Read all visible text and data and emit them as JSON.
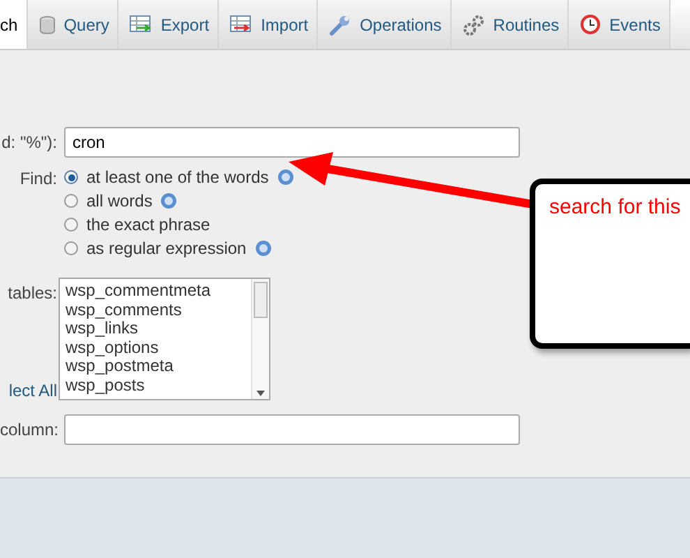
{
  "tabs": [
    {
      "label": "ch",
      "selected": true
    },
    {
      "label": "Query",
      "selected": false
    },
    {
      "label": "Export",
      "selected": false
    },
    {
      "label": "Import",
      "selected": false
    },
    {
      "label": "Operations",
      "selected": false
    },
    {
      "label": "Routines",
      "selected": false
    },
    {
      "label": "Events",
      "selected": false
    }
  ],
  "search": {
    "label": "d: \"%\"):",
    "value": "cron"
  },
  "find": {
    "label": "Find:",
    "options": [
      {
        "label": "at least one of the words",
        "help": true,
        "selected": true
      },
      {
        "label": "all words",
        "help": true,
        "selected": false
      },
      {
        "label": "the exact phrase",
        "help": false,
        "selected": false
      },
      {
        "label": "as regular expression",
        "help": true,
        "selected": false
      }
    ]
  },
  "tables": {
    "label": "tables:",
    "items": [
      "wsp_commentmeta",
      "wsp_comments",
      "wsp_links",
      "wsp_options",
      "wsp_postmeta",
      "wsp_posts"
    ],
    "select_all": "lect All"
  },
  "column": {
    "label": "column:"
  },
  "callout": {
    "text": "search for this"
  }
}
